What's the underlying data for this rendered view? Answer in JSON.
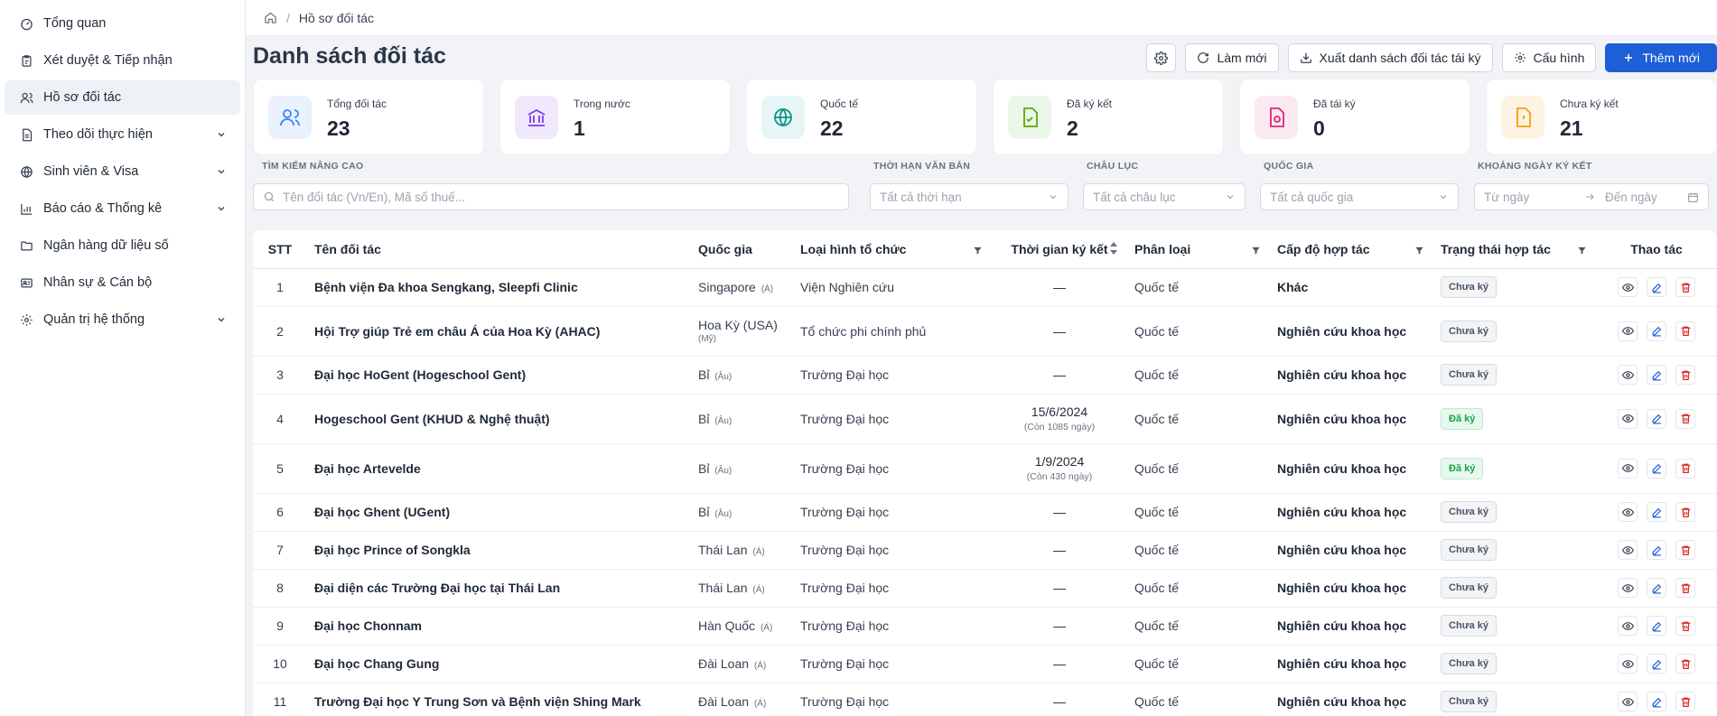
{
  "sidebar": {
    "items": [
      {
        "label": "Tổng quan",
        "icon": "dashboard-icon",
        "chevron": false,
        "active": false
      },
      {
        "label": "Xét duyệt & Tiếp nhận",
        "icon": "clipboard-icon",
        "chevron": false,
        "active": false
      },
      {
        "label": "Hồ sơ đối tác",
        "icon": "users-icon",
        "chevron": false,
        "active": true
      },
      {
        "label": "Theo dõi thực hiện",
        "icon": "document-icon",
        "chevron": true,
        "active": false
      },
      {
        "label": "Sinh viên & Visa",
        "icon": "globe-icon",
        "chevron": true,
        "active": false
      },
      {
        "label": "Báo cáo & Thống kê",
        "icon": "bar-chart-icon",
        "chevron": true,
        "active": false
      },
      {
        "label": "Ngân hàng dữ liệu số",
        "icon": "folder-icon",
        "chevron": false,
        "active": false
      },
      {
        "label": "Nhân sự & Cán bộ",
        "icon": "id-card-icon",
        "chevron": false,
        "active": false
      },
      {
        "label": "Quản trị hệ thống",
        "icon": "gear-icon",
        "chevron": true,
        "active": false
      }
    ]
  },
  "breadcrumb": {
    "separator": "/",
    "current": "Hồ sơ đối tác"
  },
  "page": {
    "title": "Danh sách đối tác"
  },
  "toolbar": {
    "refresh_label": "Làm mới",
    "export_label": "Xuất danh sách đối tác tái ký",
    "config_label": "Cấu hình",
    "add_label": "Thêm mới"
  },
  "stats": [
    {
      "label": "Tổng đối tác",
      "value": "23",
      "icon": "users-icon",
      "bg": "#e8f1fc",
      "color": "#3b82f6"
    },
    {
      "label": "Trong nước",
      "value": "1",
      "icon": "bank-icon",
      "bg": "#efe9fb",
      "color": "#7c3aed"
    },
    {
      "label": "Quốc tế",
      "value": "22",
      "icon": "globe-icon",
      "bg": "#e6f6f7",
      "color": "#0d9488"
    },
    {
      "label": "Đã ký kết",
      "value": "2",
      "icon": "file-check-icon",
      "bg": "#ebf7e8",
      "color": "#65a30d"
    },
    {
      "label": "Đã tái ký",
      "value": "0",
      "icon": "file-refresh-icon",
      "bg": "#fbe9f2",
      "color": "#db2777"
    },
    {
      "label": "Chưa ký kết",
      "value": "21",
      "icon": "file-alert-icon",
      "bg": "#fdf3e3",
      "color": "#f59e0b"
    }
  ],
  "filters": {
    "search": {
      "label": "TÌM KIẾM NÂNG CAO",
      "placeholder": "Tên đối tác (Vn/En), Mã số thuế..."
    },
    "term": {
      "label": "THỜI HẠN VĂN BẢN",
      "value": "Tất cả thời hạn"
    },
    "continent": {
      "label": "CHÂU LỤC",
      "value": "Tất cả châu lục"
    },
    "country": {
      "label": "QUỐC GIA",
      "value": "Tất cả quốc gia"
    },
    "date_range": {
      "label": "KHOẢNG NGÀY KÝ KẾT",
      "from": "Từ ngày",
      "to": "Đến ngày"
    }
  },
  "table": {
    "headers": {
      "stt": "STT",
      "name": "Tên đối tác",
      "country": "Quốc gia",
      "org_type": "Loại hình tổ chức",
      "sign_time": "Thời gian ký kết",
      "category": "Phân loại",
      "coop_level": "Cấp độ hợp tác",
      "status": "Trạng thái hợp tác",
      "actions": "Thao tác"
    },
    "rows": [
      {
        "stt": "1",
        "name": "Bệnh viện Đa khoa Sengkang, Sleepfi Clinic",
        "country": "Singapore",
        "continent": "(Á)",
        "country_sub": "",
        "org_type": "Viện Nghiên cứu",
        "date": "—",
        "date_sub": "",
        "category": "Quốc tế",
        "coop": "Khác",
        "status": "Chưa ký",
        "signed": false
      },
      {
        "stt": "2",
        "name": "Hội Trợ giúp Trẻ em châu Á của Hoa Kỳ (AHAC)",
        "country": "Hoa Kỳ (USA)",
        "continent": "",
        "country_sub": "(Mỹ)",
        "org_type": "Tổ chức phi chính phủ",
        "date": "—",
        "date_sub": "",
        "category": "Quốc tế",
        "coop": "Nghiên cứu khoa học",
        "status": "Chưa ký",
        "signed": false
      },
      {
        "stt": "3",
        "name": "Đại học HoGent (Hogeschool Gent)",
        "country": "Bỉ",
        "continent": "(Âu)",
        "country_sub": "",
        "org_type": "Trường Đại học",
        "date": "—",
        "date_sub": "",
        "category": "Quốc tế",
        "coop": "Nghiên cứu khoa học",
        "status": "Chưa ký",
        "signed": false
      },
      {
        "stt": "4",
        "name": "Hogeschool Gent (KHUD & Nghệ thuật)",
        "country": "Bỉ",
        "continent": "(Âu)",
        "country_sub": "",
        "org_type": "Trường Đại học",
        "date": "15/6/2024",
        "date_sub": "(Còn 1085 ngày)",
        "category": "Quốc tế",
        "coop": "Nghiên cứu khoa học",
        "status": "Đã ký",
        "signed": true
      },
      {
        "stt": "5",
        "name": "Đại học Artevelde",
        "country": "Bỉ",
        "continent": "(Âu)",
        "country_sub": "",
        "org_type": "Trường Đại học",
        "date": "1/9/2024",
        "date_sub": "(Còn 430 ngày)",
        "category": "Quốc tế",
        "coop": "Nghiên cứu khoa học",
        "status": "Đã ký",
        "signed": true
      },
      {
        "stt": "6",
        "name": "Đại học Ghent (UGent)",
        "country": "Bỉ",
        "continent": "(Âu)",
        "country_sub": "",
        "org_type": "Trường Đại học",
        "date": "—",
        "date_sub": "",
        "category": "Quốc tế",
        "coop": "Nghiên cứu khoa học",
        "status": "Chưa ký",
        "signed": false
      },
      {
        "stt": "7",
        "name": "Đại học Prince of Songkla",
        "country": "Thái Lan",
        "continent": "(Á)",
        "country_sub": "",
        "org_type": "Trường Đại học",
        "date": "—",
        "date_sub": "",
        "category": "Quốc tế",
        "coop": "Nghiên cứu khoa học",
        "status": "Chưa ký",
        "signed": false
      },
      {
        "stt": "8",
        "name": "Đại diện các Trường Đại học tại Thái Lan",
        "country": "Thái Lan",
        "continent": "(Á)",
        "country_sub": "",
        "org_type": "Trường Đại học",
        "date": "—",
        "date_sub": "",
        "category": "Quốc tế",
        "coop": "Nghiên cứu khoa học",
        "status": "Chưa ký",
        "signed": false
      },
      {
        "stt": "9",
        "name": "Đại học Chonnam",
        "country": "Hàn Quốc",
        "continent": "(Á)",
        "country_sub": "",
        "org_type": "Trường Đại học",
        "date": "—",
        "date_sub": "",
        "category": "Quốc tế",
        "coop": "Nghiên cứu khoa học",
        "status": "Chưa ký",
        "signed": false
      },
      {
        "stt": "10",
        "name": "Đại học Chang Gung",
        "country": "Đài Loan",
        "continent": "(Á)",
        "country_sub": "",
        "org_type": "Trường Đại học",
        "date": "—",
        "date_sub": "",
        "category": "Quốc tế",
        "coop": "Nghiên cứu khoa học",
        "status": "Chưa ký",
        "signed": false
      },
      {
        "stt": "11",
        "name": "Trường Đại học Y Trung Sơn và Bệnh viện Shing Mark",
        "country": "Đài Loan",
        "continent": "(Á)",
        "country_sub": "",
        "org_type": "Trường Đại học",
        "date": "—",
        "date_sub": "",
        "category": "Quốc tế",
        "coop": "Nghiên cứu khoa học",
        "status": "Chưa ký",
        "signed": false
      }
    ]
  },
  "colors": {
    "primary": "#1d5fd6",
    "signed_text": "#16a34a",
    "signed_bg": "#e7f8ee",
    "delete": "#dc2626"
  }
}
